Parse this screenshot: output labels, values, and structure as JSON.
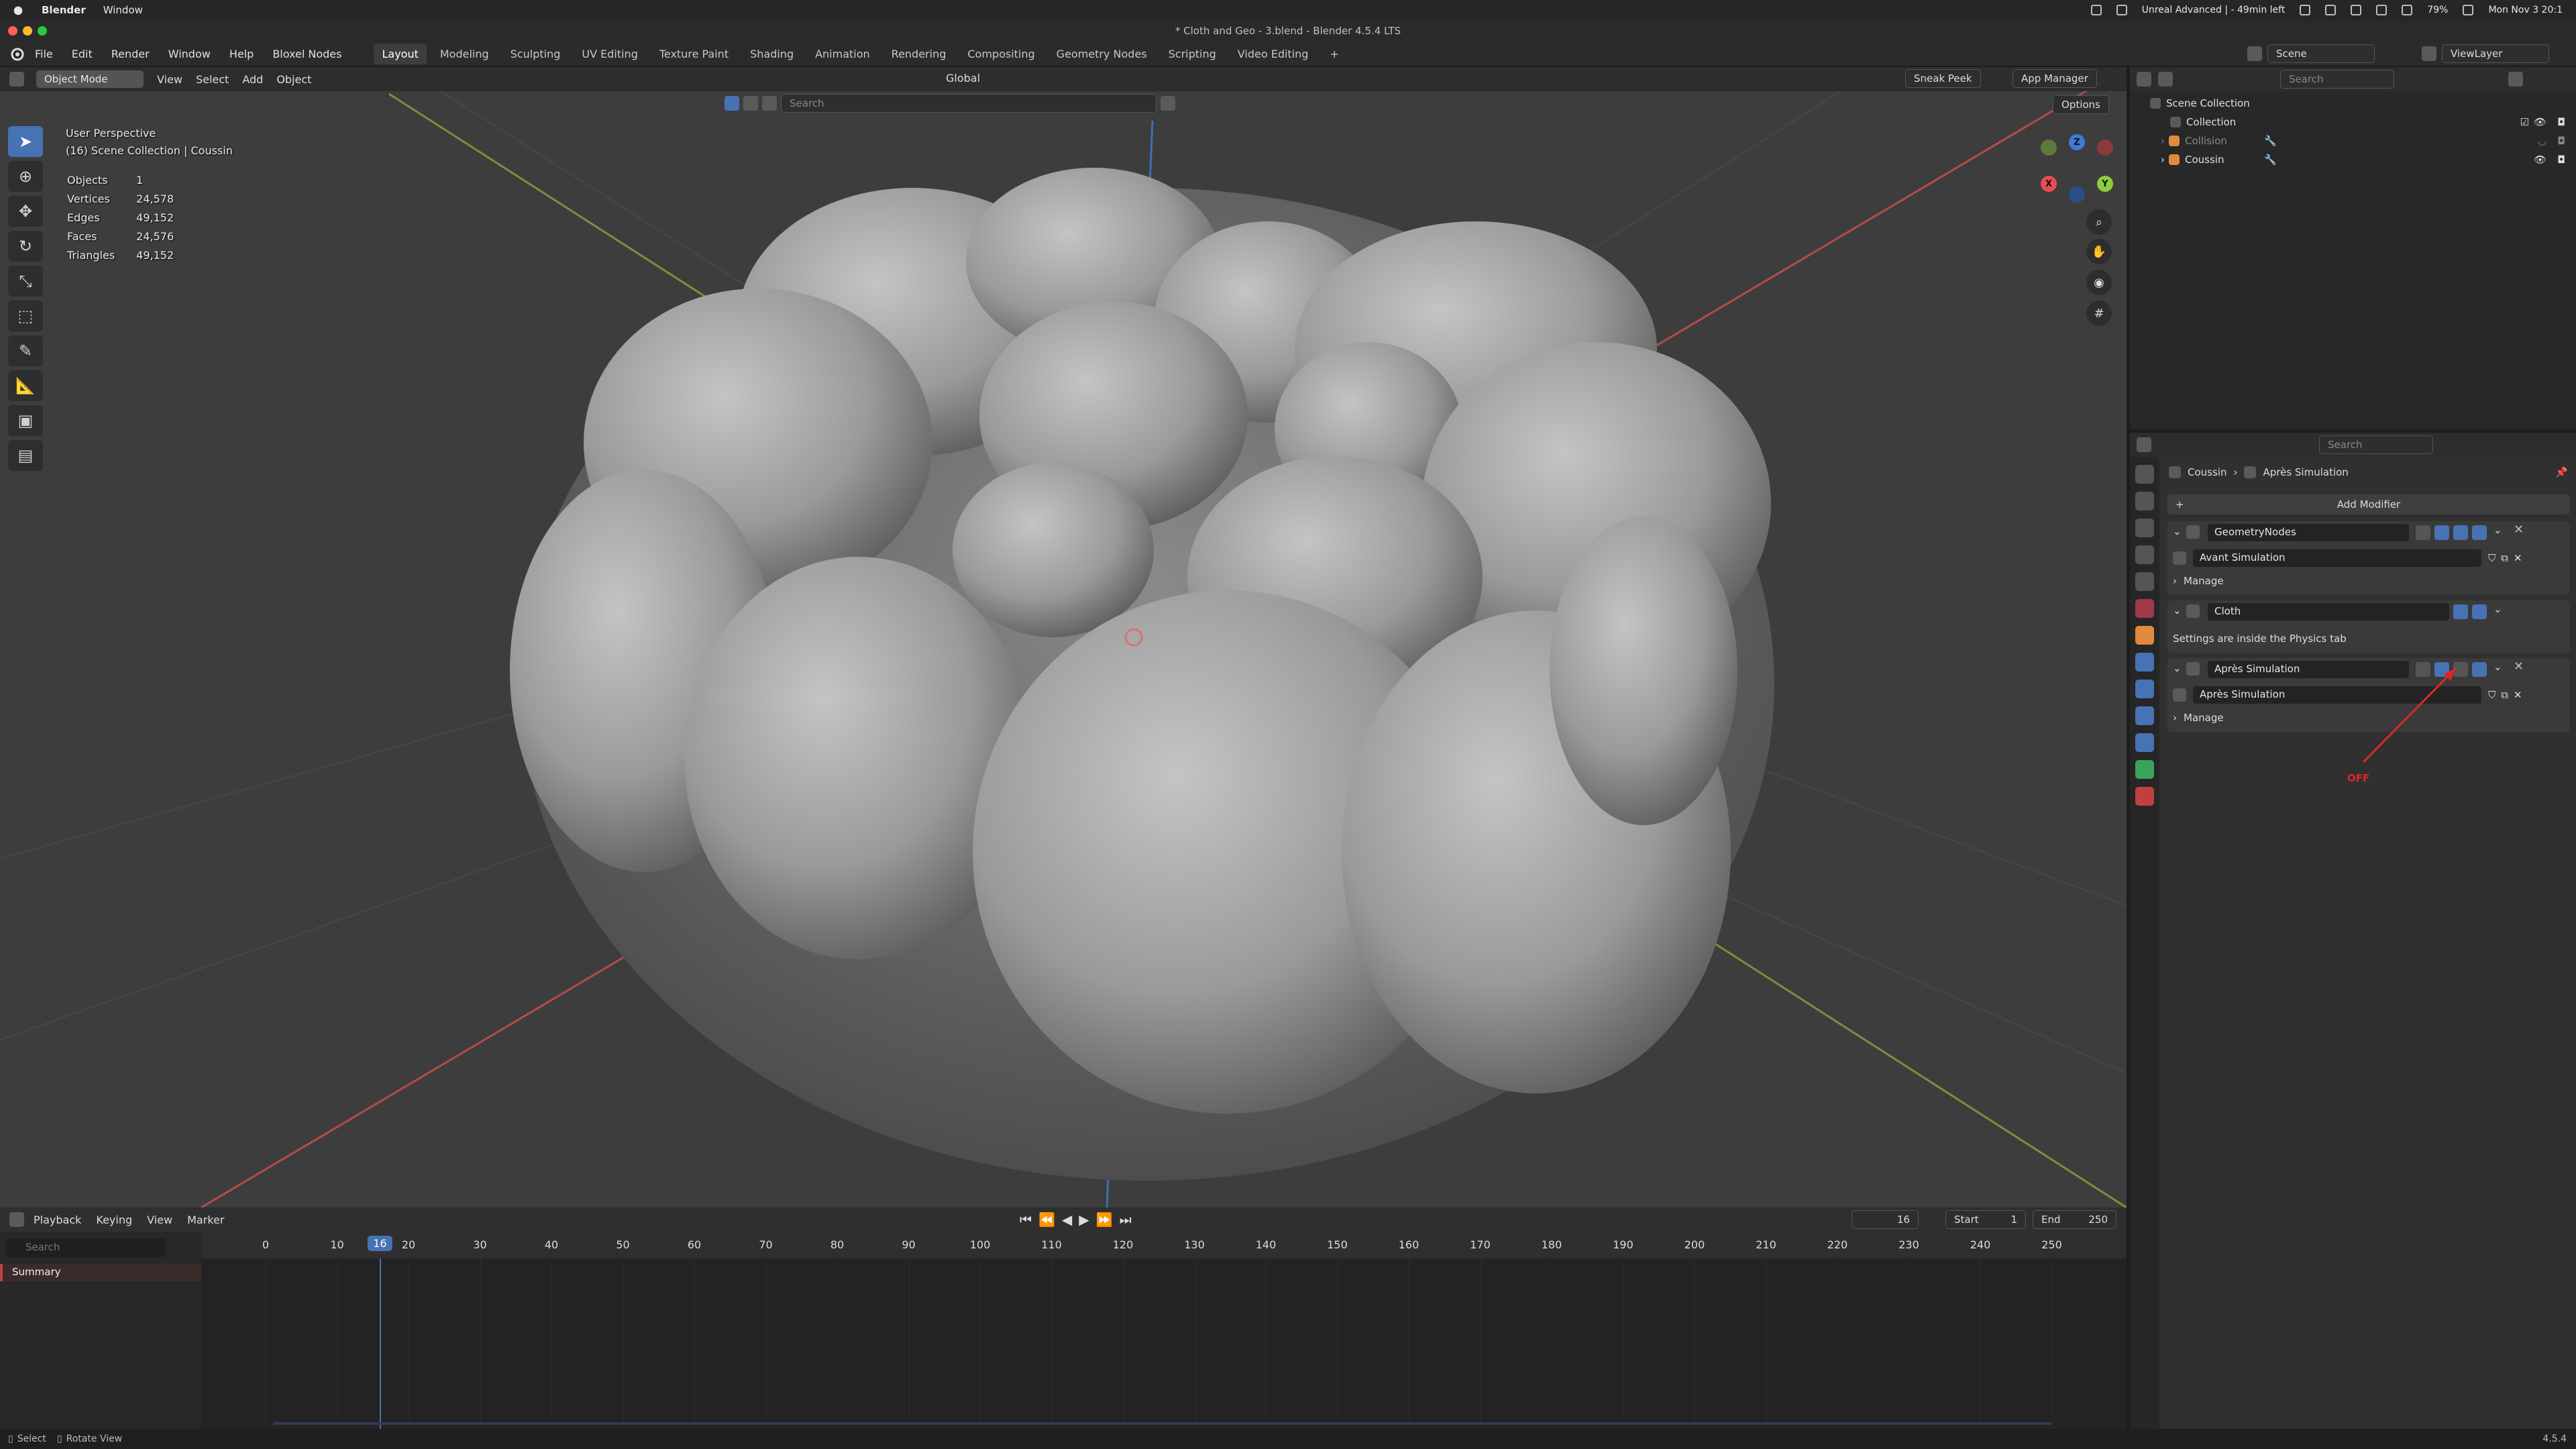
{
  "macbar": {
    "app_name": "Blender",
    "menu_window": "Window",
    "status_text": "Unreal Advanced | - 49min left",
    "battery": "79%",
    "datetime": "Mon Nov 3  20:1"
  },
  "window": {
    "title": "* Cloth and Geo - 3.blend - Blender 4.5.4 LTS"
  },
  "topbar": {
    "menus": [
      "File",
      "Edit",
      "Render",
      "Window",
      "Help",
      "Bloxel Nodes"
    ],
    "workspaces": [
      "Layout",
      "Modeling",
      "Sculpting",
      "UV Editing",
      "Texture Paint",
      "Shading",
      "Animation",
      "Rendering",
      "Compositing",
      "Geometry Nodes",
      "Scripting",
      "Video Editing"
    ],
    "active_workspace": "Layout",
    "scene_label": "Scene",
    "viewlayer_label": "ViewLayer"
  },
  "viewport": {
    "mode": "Object Mode",
    "menus": [
      "View",
      "Select",
      "Add",
      "Object"
    ],
    "orientation": "Global",
    "search_placeholder": "Search",
    "sneak_peek": "Sneak Peek",
    "app_manager": "App Manager",
    "options": "Options",
    "perspective": "User Perspective",
    "collection_path": "(16) Scene Collection | Coussin",
    "stats": [
      {
        "label": "Objects",
        "value": "1"
      },
      {
        "label": "Vertices",
        "value": "24,578"
      },
      {
        "label": "Edges",
        "value": "49,152"
      },
      {
        "label": "Faces",
        "value": "24,576"
      },
      {
        "label": "Triangles",
        "value": "49,152"
      }
    ],
    "gizmo": {
      "x": "X",
      "y": "Y",
      "z": "Z"
    }
  },
  "timeline": {
    "menus": [
      "Playback",
      "Keying",
      "View",
      "Marker"
    ],
    "current_frame": "16",
    "start_label": "Start",
    "start_value": "1",
    "end_label": "End",
    "end_value": "250",
    "search_placeholder": "Search",
    "summary": "Summary",
    "ticks": [
      "0",
      "10",
      "20",
      "30",
      "40",
      "50",
      "60",
      "70",
      "80",
      "90",
      "100",
      "110",
      "120",
      "130",
      "140",
      "150",
      "160",
      "170",
      "180",
      "190",
      "200",
      "210",
      "220",
      "230",
      "240",
      "250"
    ]
  },
  "statusbar": {
    "select": "Select",
    "rotate": "Rotate View",
    "version": "4.5.4"
  },
  "outliner": {
    "search_placeholder": "Search",
    "rows": [
      "Scene Collection",
      "Collection",
      "Collision",
      "Coussin"
    ]
  },
  "properties": {
    "search_placeholder": "Search",
    "breadcrumb_object": "Coussin",
    "breadcrumb_modifier": "Après Simulation",
    "add_modifier": "Add Modifier",
    "modifiers": [
      {
        "name": "GeometryNodes",
        "group": "Avant Simulation",
        "manage": "Manage"
      },
      {
        "name": "Cloth",
        "note": "Settings are inside the Physics tab"
      },
      {
        "name": "Après Simulation",
        "group": "Après Simulation",
        "manage": "Manage"
      }
    ],
    "annotation": "OFF"
  },
  "colors": {
    "accent": "#4772b3",
    "annotation": "#e0242c",
    "x_axis": "#c8333b",
    "y_axis": "#8bb13a",
    "z_axis": "#3d7bd6"
  }
}
